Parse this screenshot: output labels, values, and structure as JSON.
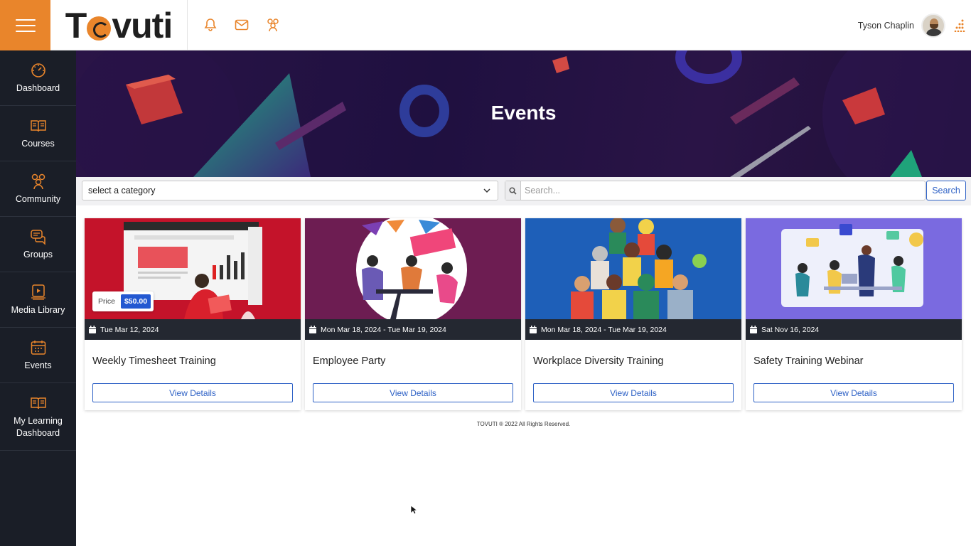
{
  "brand": {
    "logo_text_before": "T",
    "logo_text_after": "vuti",
    "accent": "#e9852b"
  },
  "header": {
    "icons": [
      "bell-icon",
      "mail-icon",
      "community-icon"
    ],
    "user_name": "Tyson Chaplin"
  },
  "sidebar": {
    "items": [
      {
        "label": "Dashboard",
        "icon": "dashboard-icon"
      },
      {
        "label": "Courses",
        "icon": "book-icon"
      },
      {
        "label": "Community",
        "icon": "community-icon"
      },
      {
        "label": "Groups",
        "icon": "chat-icon"
      },
      {
        "label": "Media Library",
        "icon": "media-icon"
      },
      {
        "label": "Events",
        "icon": "calendar-icon"
      },
      {
        "label": "My Learning Dashboard",
        "icon": "book-icon"
      }
    ]
  },
  "hero": {
    "title": "Events"
  },
  "filters": {
    "category_value": "select a category",
    "search_placeholder": "Search...",
    "search_label": "Search"
  },
  "events": [
    {
      "date": "Tue Mar 12, 2024",
      "title": "Weekly Timesheet Training",
      "button": "View Details",
      "price_label": "Price",
      "price": "$50.00"
    },
    {
      "date": "Mon Mar 18, 2024 - Tue Mar 19, 2024",
      "title": "Employee Party",
      "button": "View Details"
    },
    {
      "date": "Mon Mar 18, 2024 - Tue Mar 19, 2024",
      "title": "Workplace Diversity Training",
      "button": "View Details"
    },
    {
      "date": "Sat Nov 16, 2024",
      "title": "Safety Training Webinar",
      "button": "View Details"
    }
  ],
  "footer": {
    "text": "TOVUTI ® 2022 All Rights Reserved."
  }
}
